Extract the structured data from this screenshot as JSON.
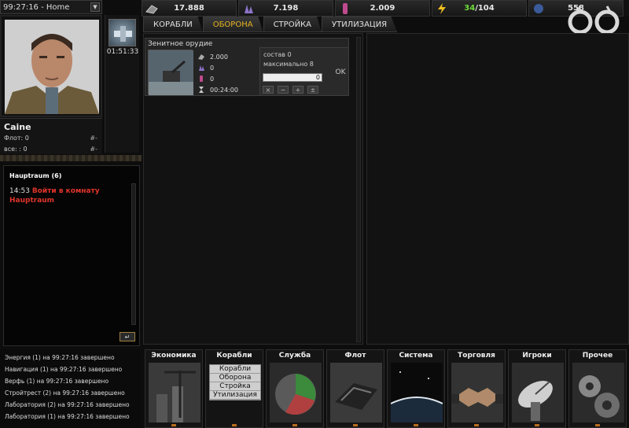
{
  "planet": {
    "name": "99:27:16 - Home"
  },
  "resources": [
    {
      "key": "metal",
      "icon": "metal-icon",
      "value": "17.888"
    },
    {
      "key": "crystal",
      "icon": "crystal-icon",
      "value": "7.198"
    },
    {
      "key": "deuterium",
      "icon": "deuterium-icon",
      "value": "2.009"
    },
    {
      "key": "energy",
      "icon": "energy-icon",
      "value_used": "34",
      "value_total": "/104"
    },
    {
      "key": "dark",
      "icon": "darkmatter-icon",
      "value": "558"
    }
  ],
  "player": {
    "name": "Caine",
    "fleet_label": "Флот: 0",
    "all_label": "все: : 0",
    "hash1": "#-",
    "hash2": "#-"
  },
  "mission": {
    "time": "01:51:33"
  },
  "chat": {
    "title": "Hauptraum (6)",
    "time": "14:53",
    "link": "Войти в комнату Hauptraum",
    "enter": "↵"
  },
  "events": [
    "Энергия (1) на 99:27:16 завершено",
    "Навигация (1) на 99:27:16 завершено",
    "Верфь (1) на 99:27:16 завершено",
    "Стройтрест (2) на 99:27:16 завершено",
    "Лаборатория (2) на 99:27:16 завершено",
    "Лаборатория (1) на 99:27:16 завершено"
  ],
  "tabs": [
    "КОРАБЛИ",
    "ОБОРОНА",
    "СТРОЙКА",
    "УТИЛИЗАЦИЯ"
  ],
  "card": {
    "title": "Зенитное орудие",
    "cost_metal": "2.000",
    "cost_crystal": "0",
    "cost_deut": "0",
    "time": "00:24:00",
    "stock": "состав 0",
    "max": "максимально 8",
    "qty": "0",
    "ok": "OK",
    "btn_x": "×",
    "btn_minus": "−",
    "btn_plus": "+",
    "btn_max": "±"
  },
  "nav": [
    {
      "label": "Экономика"
    },
    {
      "label": "Корабли"
    },
    {
      "label": "Служба"
    },
    {
      "label": "Флот"
    },
    {
      "label": "Система"
    },
    {
      "label": "Торговля"
    },
    {
      "label": "Игроки"
    },
    {
      "label": "Прочее"
    }
  ],
  "submenu": [
    "Корабли",
    "Оборона",
    "Стройка",
    "Утилизация"
  ],
  "colors": {
    "accent": "#e6b320",
    "energy": "#6fdc3a",
    "link": "#e0352b"
  }
}
